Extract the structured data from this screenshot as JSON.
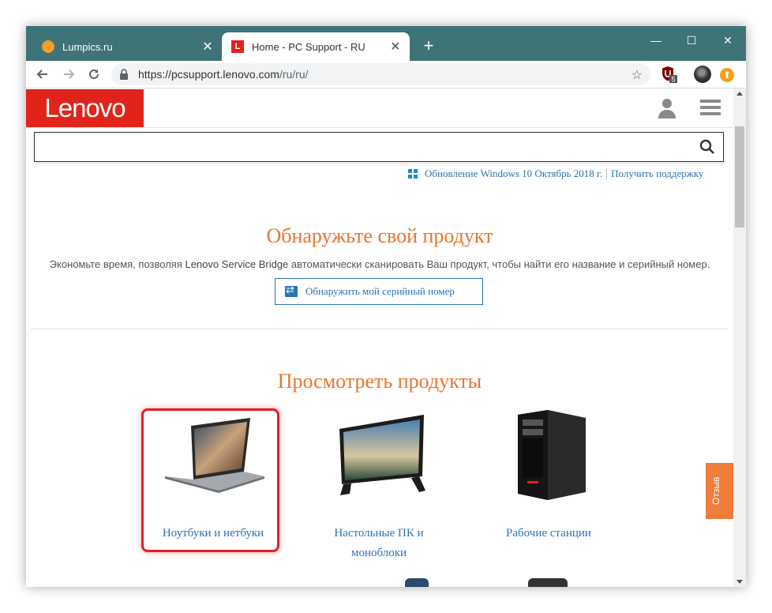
{
  "browser": {
    "tabs": [
      {
        "title": "Lumpics.ru",
        "favicon": "orange-circle-icon",
        "active": false
      },
      {
        "title": "Home - PC Support - RU",
        "favicon": "lenovo-l-icon",
        "active": true
      }
    ],
    "favicon_letter": "L",
    "new_tab_label": "+",
    "close_glyph": "✕",
    "window_controls": {
      "minimize": "—",
      "maximize": "☐",
      "close": "✕"
    },
    "url_host": "https://pcsupport.lenovo.com",
    "url_path": "/ru/ru/",
    "extensions": [
      {
        "name": "ublock-icon",
        "badge": "5"
      },
      {
        "name": "profile-avatar"
      },
      {
        "name": "orange-extension-icon",
        "glyph": "⬆"
      }
    ],
    "colors": {
      "tabstrip": "#3e7378",
      "accent": "#e2231a"
    }
  },
  "site": {
    "logo_text": "Lenovo",
    "search": {
      "value": "",
      "placeholder": ""
    },
    "top_links": {
      "windows_update": "Обновление Windows 10 Октябрь 2018 г.",
      "get_support": "Получить поддержку"
    },
    "detect": {
      "title": "Обнаружьте свой продукт",
      "desc_before": "Экономьте время, позволяя ",
      "desc_brand": "Lenovo Service Bridge",
      "desc_after": " автоматически сканировать Ваш продукт, чтобы найти его название и серийный номер.",
      "button": "Обнаружить мой серийный номер"
    },
    "browse": {
      "title": "Просмотреть продукты",
      "products": [
        {
          "label": "Ноутбуки и нетбуки",
          "icon": "laptop-image",
          "highlighted": true
        },
        {
          "label": "Настольные ПК и моноблоки",
          "icon": "all-in-one-desktop-image",
          "highlighted": false
        },
        {
          "label": "Рабочие станции",
          "icon": "workstation-tower-image",
          "highlighted": false
        }
      ]
    },
    "feedback_label": "Отзыв",
    "colors": {
      "orange": "#e8762e",
      "link": "#2b73b7",
      "highlight": "#e21f26",
      "feedback": "#f07d3a"
    }
  }
}
